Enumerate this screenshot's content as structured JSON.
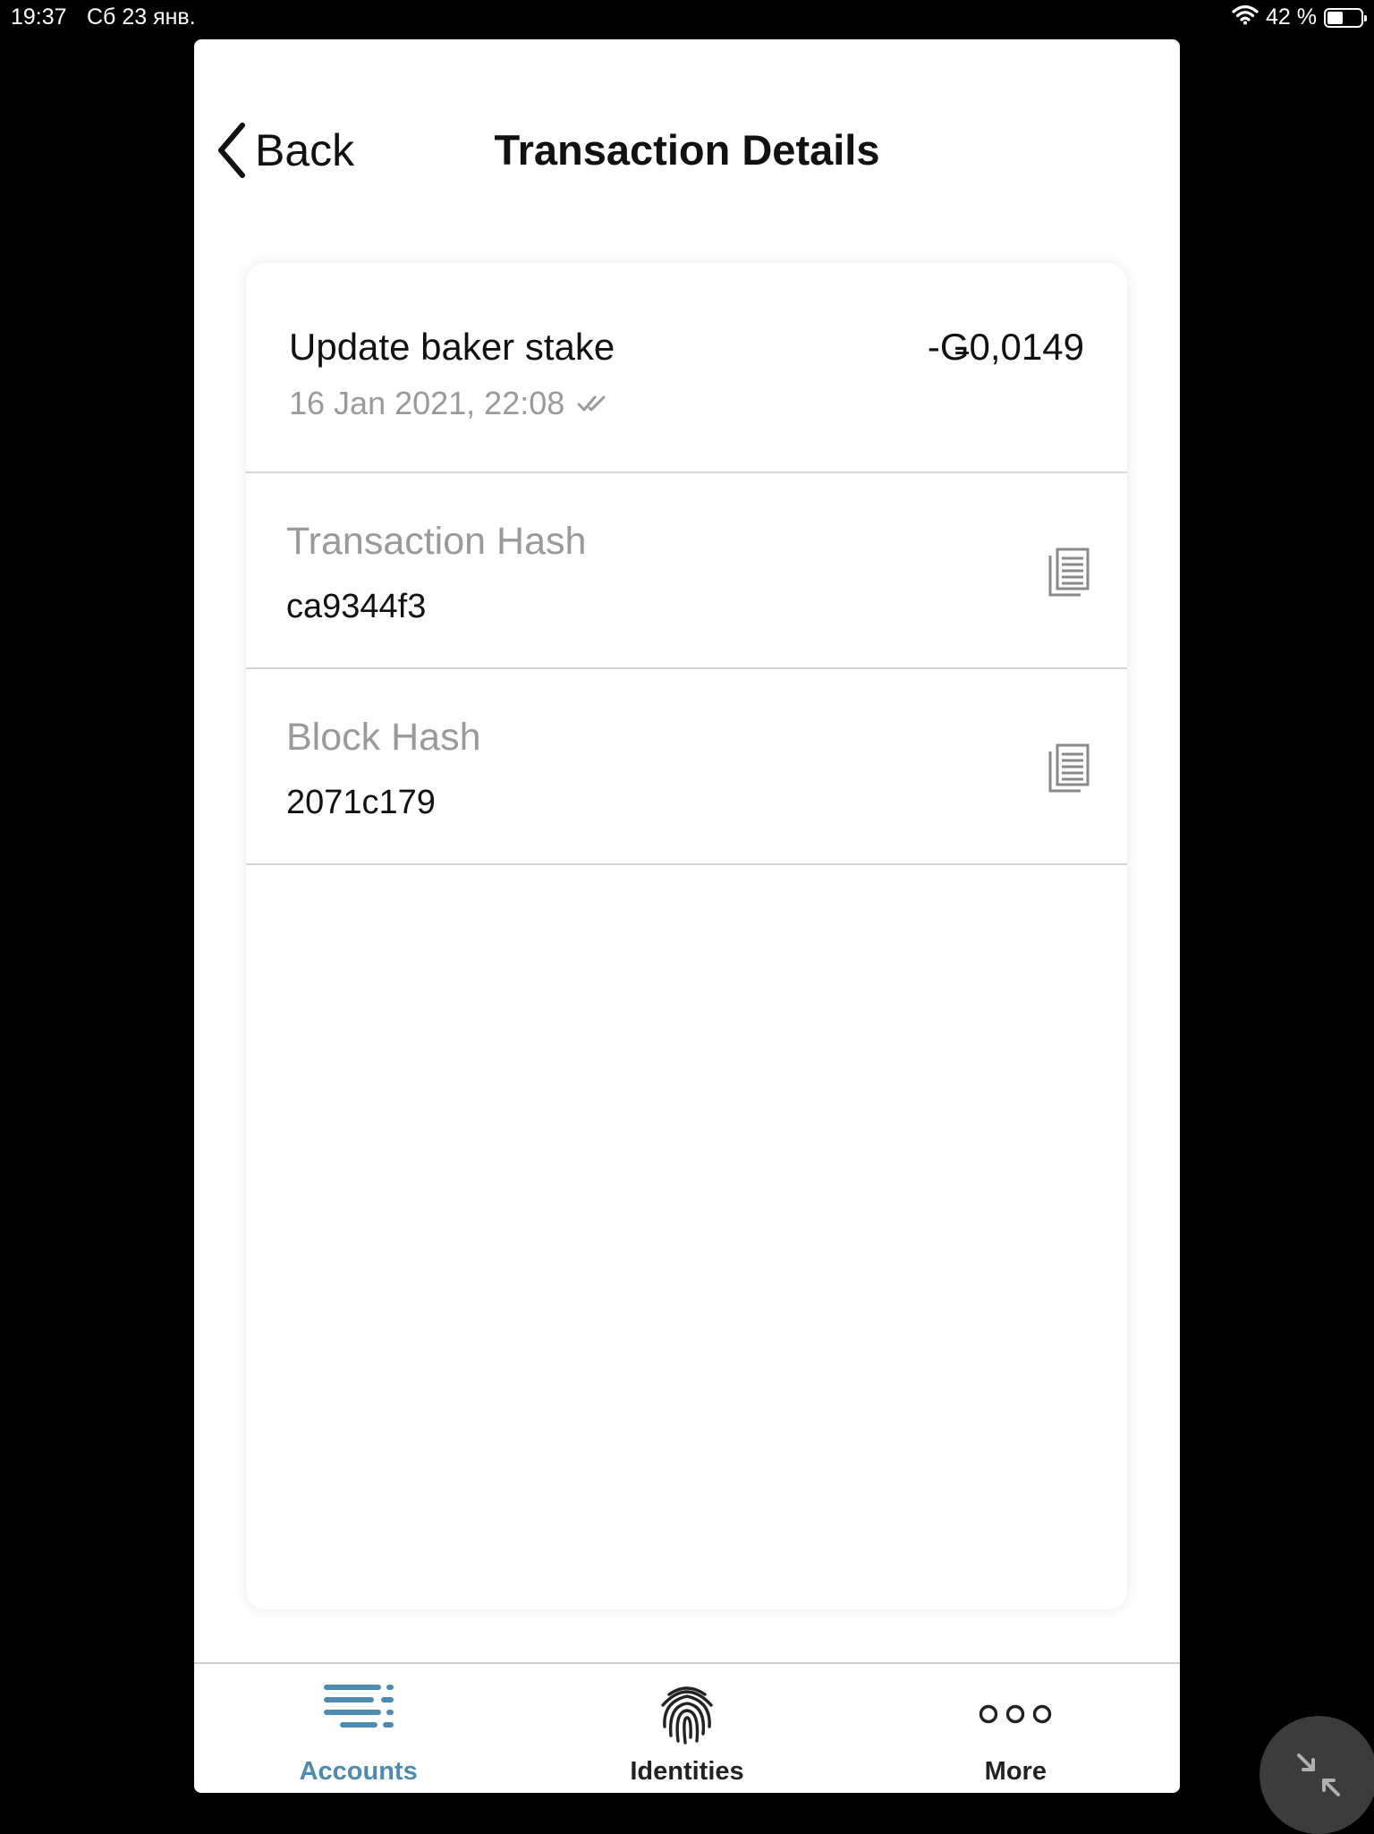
{
  "status_bar": {
    "time": "19:37",
    "date": "Сб 23 янв.",
    "battery": "42 %",
    "battery_level": 0.42
  },
  "nav": {
    "back_label": "Back",
    "title": "Transaction Details"
  },
  "transaction": {
    "title": "Update baker stake",
    "amount": "-Ǥ0,0149",
    "date": "16 Jan 2021, 22:08",
    "status_icon": "double-check-icon"
  },
  "hashes": [
    {
      "label": "Transaction Hash",
      "value": "ca9344f3",
      "icon": "copy-icon"
    },
    {
      "label": "Block Hash",
      "value": "2071c179",
      "icon": "copy-icon"
    }
  ],
  "tabs": [
    {
      "label": "Accounts",
      "icon": "accounts-list-icon",
      "active": true
    },
    {
      "label": "Identities",
      "icon": "fingerprint-icon",
      "active": false
    },
    {
      "label": "More",
      "icon": "more-dots-icon",
      "active": false
    }
  ],
  "colors": {
    "accent": "#4f8bb1",
    "text": "#111111",
    "muted": "#9a9a9a",
    "divider": "#d6d6d6"
  }
}
